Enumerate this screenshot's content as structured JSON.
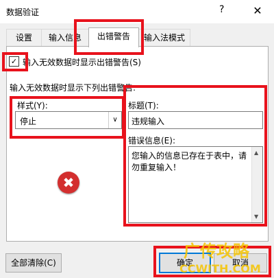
{
  "window": {
    "title": "数据验证",
    "help": "?",
    "close": "✕"
  },
  "tabs": [
    {
      "label": "设置"
    },
    {
      "label": "输入信息"
    },
    {
      "label": "出错警告"
    },
    {
      "label": "输入法模式"
    }
  ],
  "show_error_alert": {
    "label": "输入无效数据时显示出错警告(S)",
    "checked": true,
    "check": "✓"
  },
  "section_label": "输入无效数据时显示下列出错警告:",
  "style": {
    "label": "样式(Y):",
    "value": "停止",
    "arrow": "∨"
  },
  "title_field": {
    "label": "标题(T):",
    "value": "违规输入"
  },
  "message_field": {
    "label": "错误信息(E):",
    "value": "您输入的信息已存在于表中，请勿重复输入！"
  },
  "error_icon": {
    "icon": "error-icon",
    "glyph": "✖"
  },
  "buttons": {
    "clear_all": "全部清除(C)",
    "ok": "确定",
    "cancel": "取消"
  },
  "watermark": {
    "text1": "广传攻略",
    "text2": "CCWITH.COM"
  },
  "colors": {
    "highlight": "#e8121c",
    "accent": "#0078d7",
    "error": "#d32f2f"
  }
}
